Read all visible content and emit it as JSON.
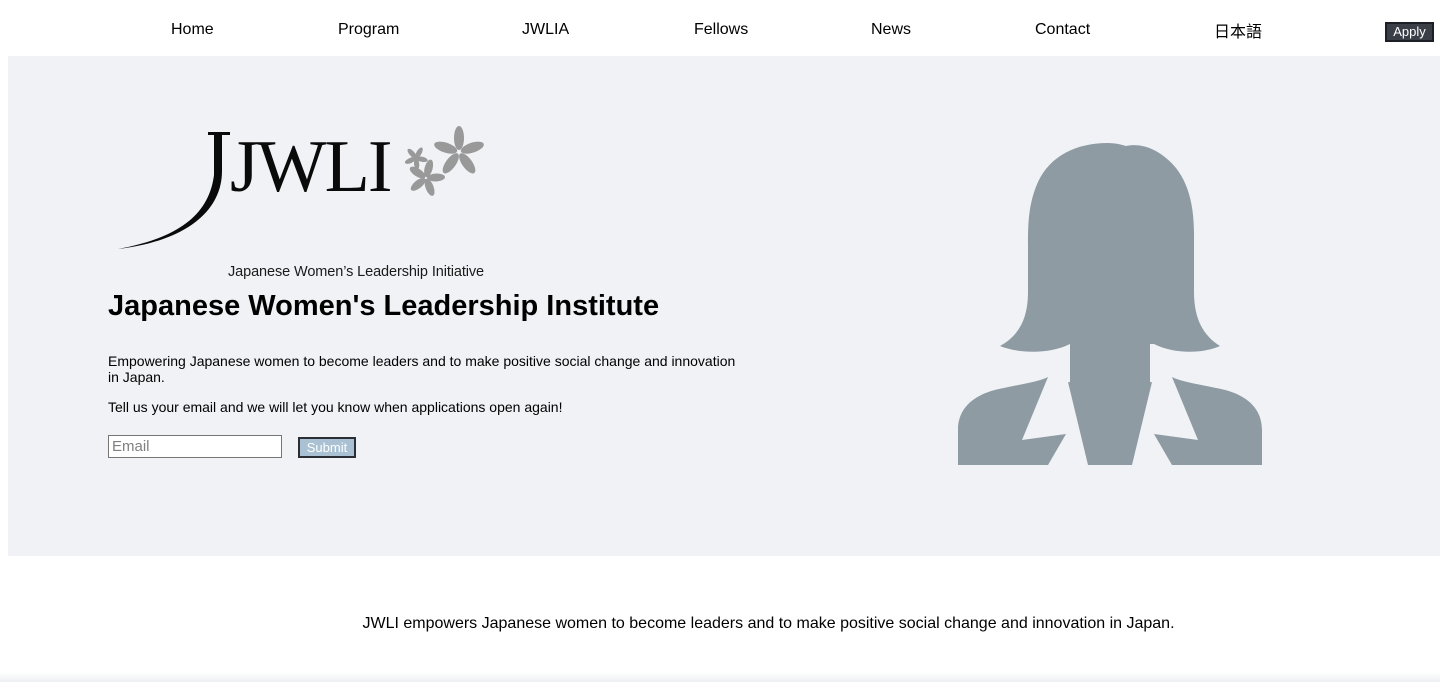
{
  "nav": {
    "items": [
      {
        "label": "Home"
      },
      {
        "label": "Program"
      },
      {
        "label": "JWLIA"
      },
      {
        "label": "Fellows"
      },
      {
        "label": "News"
      },
      {
        "label": "Contact"
      },
      {
        "label": "日本語"
      }
    ],
    "apply_label": "Apply"
  },
  "hero": {
    "logo": {
      "wordmark": "JWLI",
      "tagline": "Japanese Women’s Leadership Initiative",
      "icon": "sakura-blossoms-icon"
    },
    "title": "Japanese Women's Leadership Institute",
    "description": "Empowering Japanese women to become leaders and to make positive social change and innovation in Japan.",
    "cta_text": "Tell us your email and we will let you know when applications open again!",
    "email_placeholder": "Email",
    "submit_label": "Submit",
    "avatar_icon": "woman-silhouette-icon"
  },
  "mission": {
    "text": "JWLI empowers Japanese women to become leaders and to make positive social change and innovation in Japan."
  },
  "colors": {
    "hero_background": "#f0f2f6",
    "avatar_gray": "#8e9ba3",
    "logo_blossom_gray": "#999999",
    "apply_background": "#3a3f47",
    "submit_background": "#a9c1d2"
  }
}
